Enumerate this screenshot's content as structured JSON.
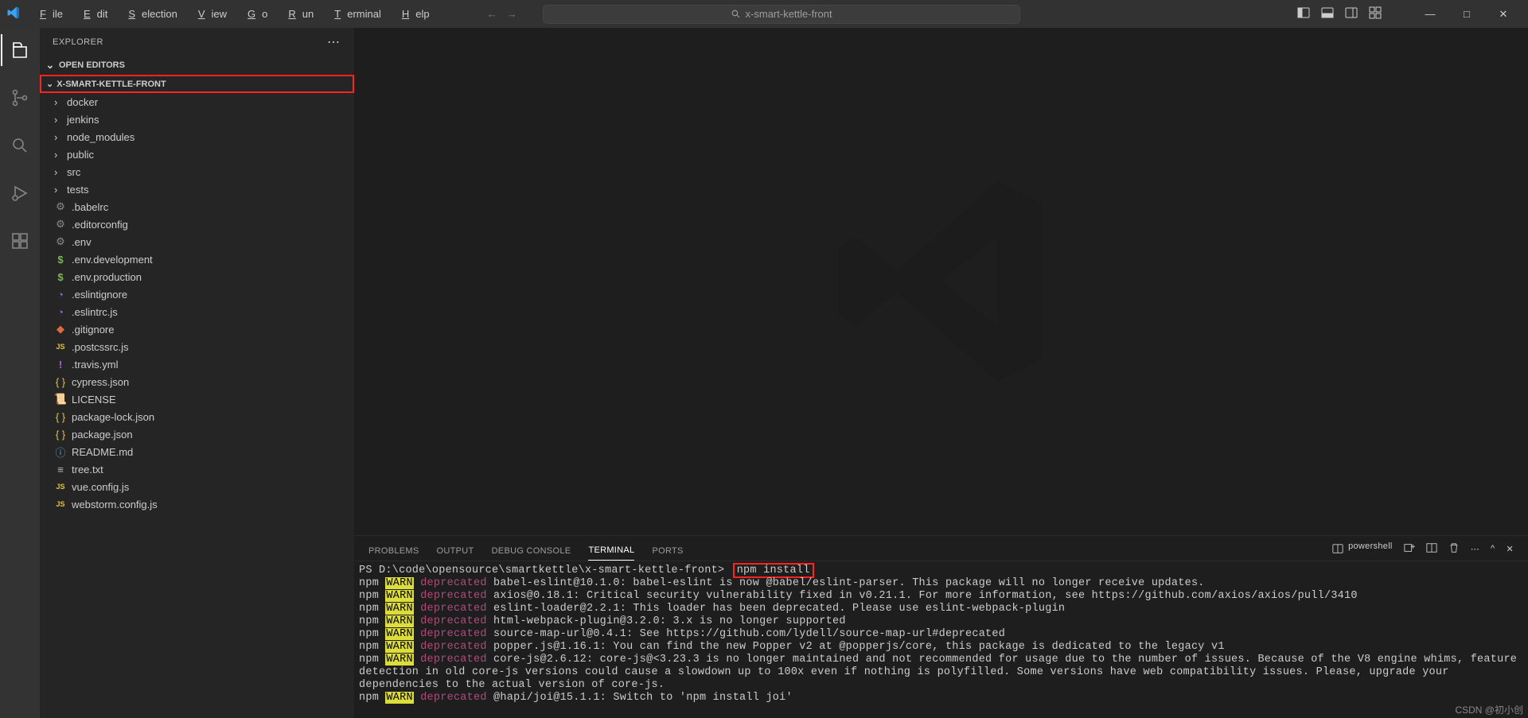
{
  "menubar": {
    "items": [
      {
        "mn": "F",
        "rest": "ile"
      },
      {
        "mn": "E",
        "rest": "dit"
      },
      {
        "mn": "S",
        "rest": "election"
      },
      {
        "mn": "V",
        "rest": "iew"
      },
      {
        "mn": "G",
        "rest": "o"
      },
      {
        "mn": "R",
        "rest": "un"
      },
      {
        "mn": "T",
        "rest": "erminal"
      },
      {
        "mn": "H",
        "rest": "elp"
      }
    ],
    "search_placeholder": "x-smart-kettle-front"
  },
  "sidebar": {
    "title": "EXPLORER",
    "open_editors": "OPEN EDITORS",
    "project": "X-SMART-KETTLE-FRONT",
    "folders": [
      "docker",
      "jenkins",
      "node_modules",
      "public",
      "src",
      "tests"
    ],
    "files": [
      {
        "icon": "gear",
        "name": ".babelrc"
      },
      {
        "icon": "gear",
        "name": ".editorconfig"
      },
      {
        "icon": "gear",
        "name": ".env"
      },
      {
        "icon": "dollar",
        "name": ".env.development"
      },
      {
        "icon": "dollar",
        "name": ".env.production"
      },
      {
        "icon": "circle",
        "name": ".eslintignore"
      },
      {
        "icon": "circle",
        "name": ".eslintrc.js"
      },
      {
        "icon": "git",
        "name": ".gitignore"
      },
      {
        "icon": "js",
        "name": ".postcssrc.js"
      },
      {
        "icon": "excl",
        "name": ".travis.yml"
      },
      {
        "icon": "json",
        "name": "cypress.json"
      },
      {
        "icon": "lic",
        "name": "LICENSE"
      },
      {
        "icon": "json",
        "name": "package-lock.json"
      },
      {
        "icon": "json",
        "name": "package.json"
      },
      {
        "icon": "info",
        "name": "README.md"
      },
      {
        "icon": "lines",
        "name": "tree.txt"
      },
      {
        "icon": "js",
        "name": "vue.config.js"
      },
      {
        "icon": "js",
        "name": "webstorm.config.js"
      }
    ]
  },
  "panel": {
    "tabs": {
      "problems": "PROBLEMS",
      "output": "OUTPUT",
      "debug": "DEBUG CONSOLE",
      "terminal": "TERMINAL",
      "ports": "PORTS"
    },
    "shell": "powershell"
  },
  "terminal": {
    "prompt": "PS D:\\code\\opensource\\smartkettle\\x-smart-kettle-front>",
    "command": "npm install",
    "lines": [
      {
        "pkg": "babel-eslint@10.1.0",
        "msg": ": babel-eslint is now @babel/eslint-parser. This package will no longer receive updates."
      },
      {
        "pkg": "axios@0.18.1",
        "msg": ": Critical security vulnerability fixed in v0.21.1. For more information, see https://github.com/axios/axios/pull/3410",
        "wrap": true
      },
      {
        "pkg": "eslint-loader@2.2.1",
        "msg": ": This loader has been deprecated. Please use eslint-webpack-plugin"
      },
      {
        "pkg": "html-webpack-plugin@3.2.0",
        "msg": ": 3.x is no longer supported"
      },
      {
        "pkg": "source-map-url@0.4.1",
        "msg": ": See https://github.com/lydell/source-map-url#deprecated"
      },
      {
        "pkg": "popper.js@1.16.1",
        "msg": ": You can find the new Popper v2 at @popperjs/core, this package is dedicated to the legacy v1"
      },
      {
        "pkg": "core-js@2.6.12",
        "msg": ": core-js@<3.23.3 is no longer maintained and not recommended for usage due to the number of issues. Because of the V8 engine whims, feature detection in old core-js versions could cause a slowdown up to 100x even if nothing is polyfilled. Some versions have web compatibility issues. Please, upgrade your dependencies to the actual version of core-js.",
        "wrap3": true
      },
      {
        "pkg": "@hapi/joi@15.1.1",
        "msg": ": Switch to 'npm install joi'"
      }
    ]
  },
  "watermark": "CSDN @初小创"
}
